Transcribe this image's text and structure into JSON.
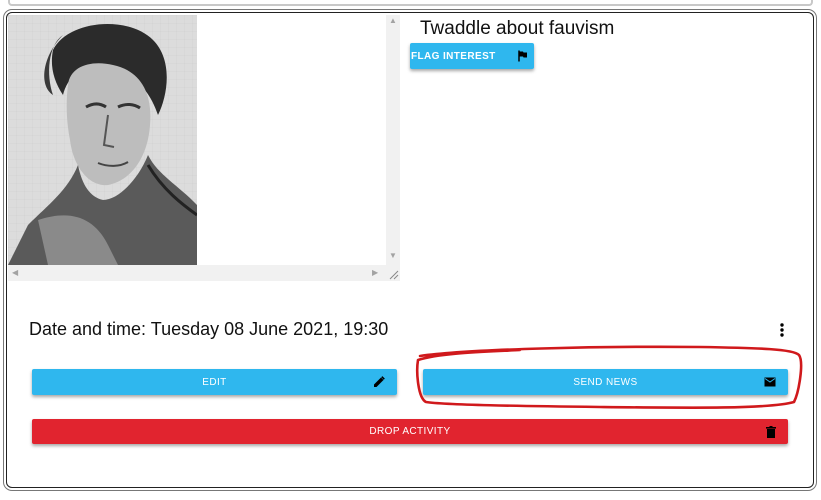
{
  "activity": {
    "title": "Twaddle about fauvism",
    "flag_interest_label": "FLAG INTEREST",
    "datetime_label": "Date and time: Tuesday 08 June 2021, 19:30"
  },
  "actions": {
    "edit_label": "EDIT",
    "send_news_label": "SEND NEWS",
    "drop_activity_label": "DROP ACTIVITY"
  },
  "icons": {
    "flag": "flag-icon",
    "edit": "pencil-icon",
    "send_news": "envelope-icon",
    "drop": "trash-icon",
    "more": "more-vertical-icon"
  },
  "colors": {
    "primary_button": "#2fb7ee",
    "danger_button": "#e1242f",
    "annotation": "#d0191c"
  }
}
